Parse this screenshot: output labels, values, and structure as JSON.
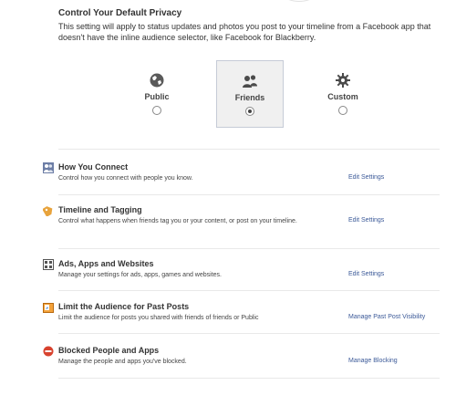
{
  "privacy": {
    "heading": "Control Your Default Privacy",
    "description": "This setting will apply to status updates and photos you post to your timeline from a Facebook app that doesn't have the inline audience selector, like Facebook for Blackberry.",
    "options": [
      {
        "label": "Public",
        "icon": "globe-icon",
        "selected": false
      },
      {
        "label": "Friends",
        "icon": "friends-icon",
        "selected": true
      },
      {
        "label": "Custom",
        "icon": "gear-icon",
        "selected": false
      }
    ]
  },
  "sections": [
    {
      "title": "How You Connect",
      "description": "Control how you connect with people you know.",
      "link": "Edit Settings",
      "icon": "people-icon"
    },
    {
      "title": "Timeline and Tagging",
      "description": "Control what happens when friends tag you or your content, or post on your timeline.",
      "link": "Edit Settings",
      "icon": "tag-icon"
    },
    {
      "title": "Ads, Apps and Websites",
      "description": "Manage your settings for ads, apps, games and websites.",
      "link": "Edit Settings",
      "icon": "apps-icon"
    },
    {
      "title": "Limit the Audience for Past Posts",
      "description": "Limit the audience for posts you shared with friends of friends or Public",
      "link": "Manage Past Post Visibility",
      "icon": "past-posts-icon"
    },
    {
      "title": "Blocked People and Apps",
      "description": "Manage the people and apps you've blocked.",
      "link": "Manage Blocking",
      "icon": "blocked-icon"
    }
  ],
  "colors": {
    "link": "#3b5998",
    "blocked": "#d8432f",
    "tag": "#e8a33c"
  }
}
